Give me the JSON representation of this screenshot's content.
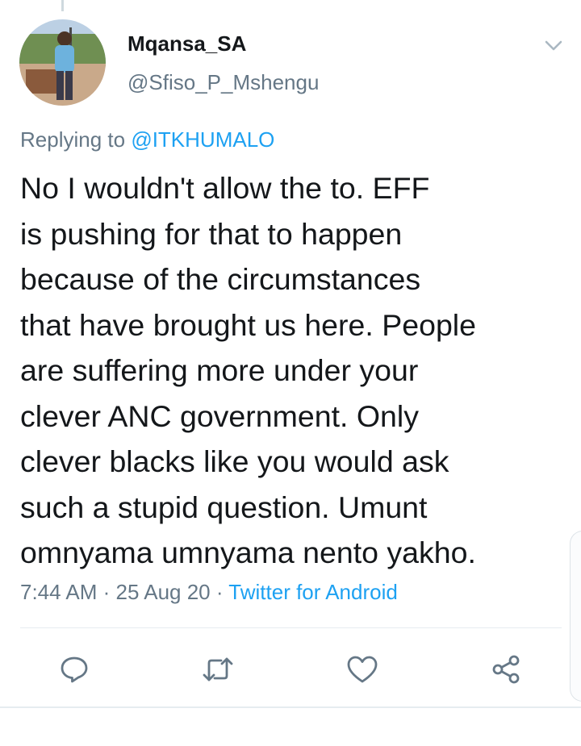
{
  "tweet": {
    "display_name": "Mqansa_SA",
    "handle": "@Sfiso_P_Mshengu",
    "replying_prefix": "Replying to ",
    "replying_to": "@ITKHUMALO",
    "text": "No I wouldn't allow the to. EFF\nis pushing for that to happen\nbecause of the circumstances\nthat have brought us here. People\nare suffering more under your\nclever ANC government. Only\nclever blacks like you would ask\nsuch a stupid question. Umunt\nomnyama umnyama nento yakho.",
    "time": "7:44 AM",
    "separator": " · ",
    "date": "25 Aug 20",
    "source": "Twitter for Android"
  },
  "actions": [
    {
      "name": "reply",
      "icon": "reply-icon"
    },
    {
      "name": "retweet",
      "icon": "retweet-icon"
    },
    {
      "name": "like",
      "icon": "heart-icon"
    },
    {
      "name": "share",
      "icon": "share-icon"
    }
  ],
  "colors": {
    "text": "#14171a",
    "secondary": "#657786",
    "link": "#1da1f2",
    "divider": "#e6ecf0"
  }
}
